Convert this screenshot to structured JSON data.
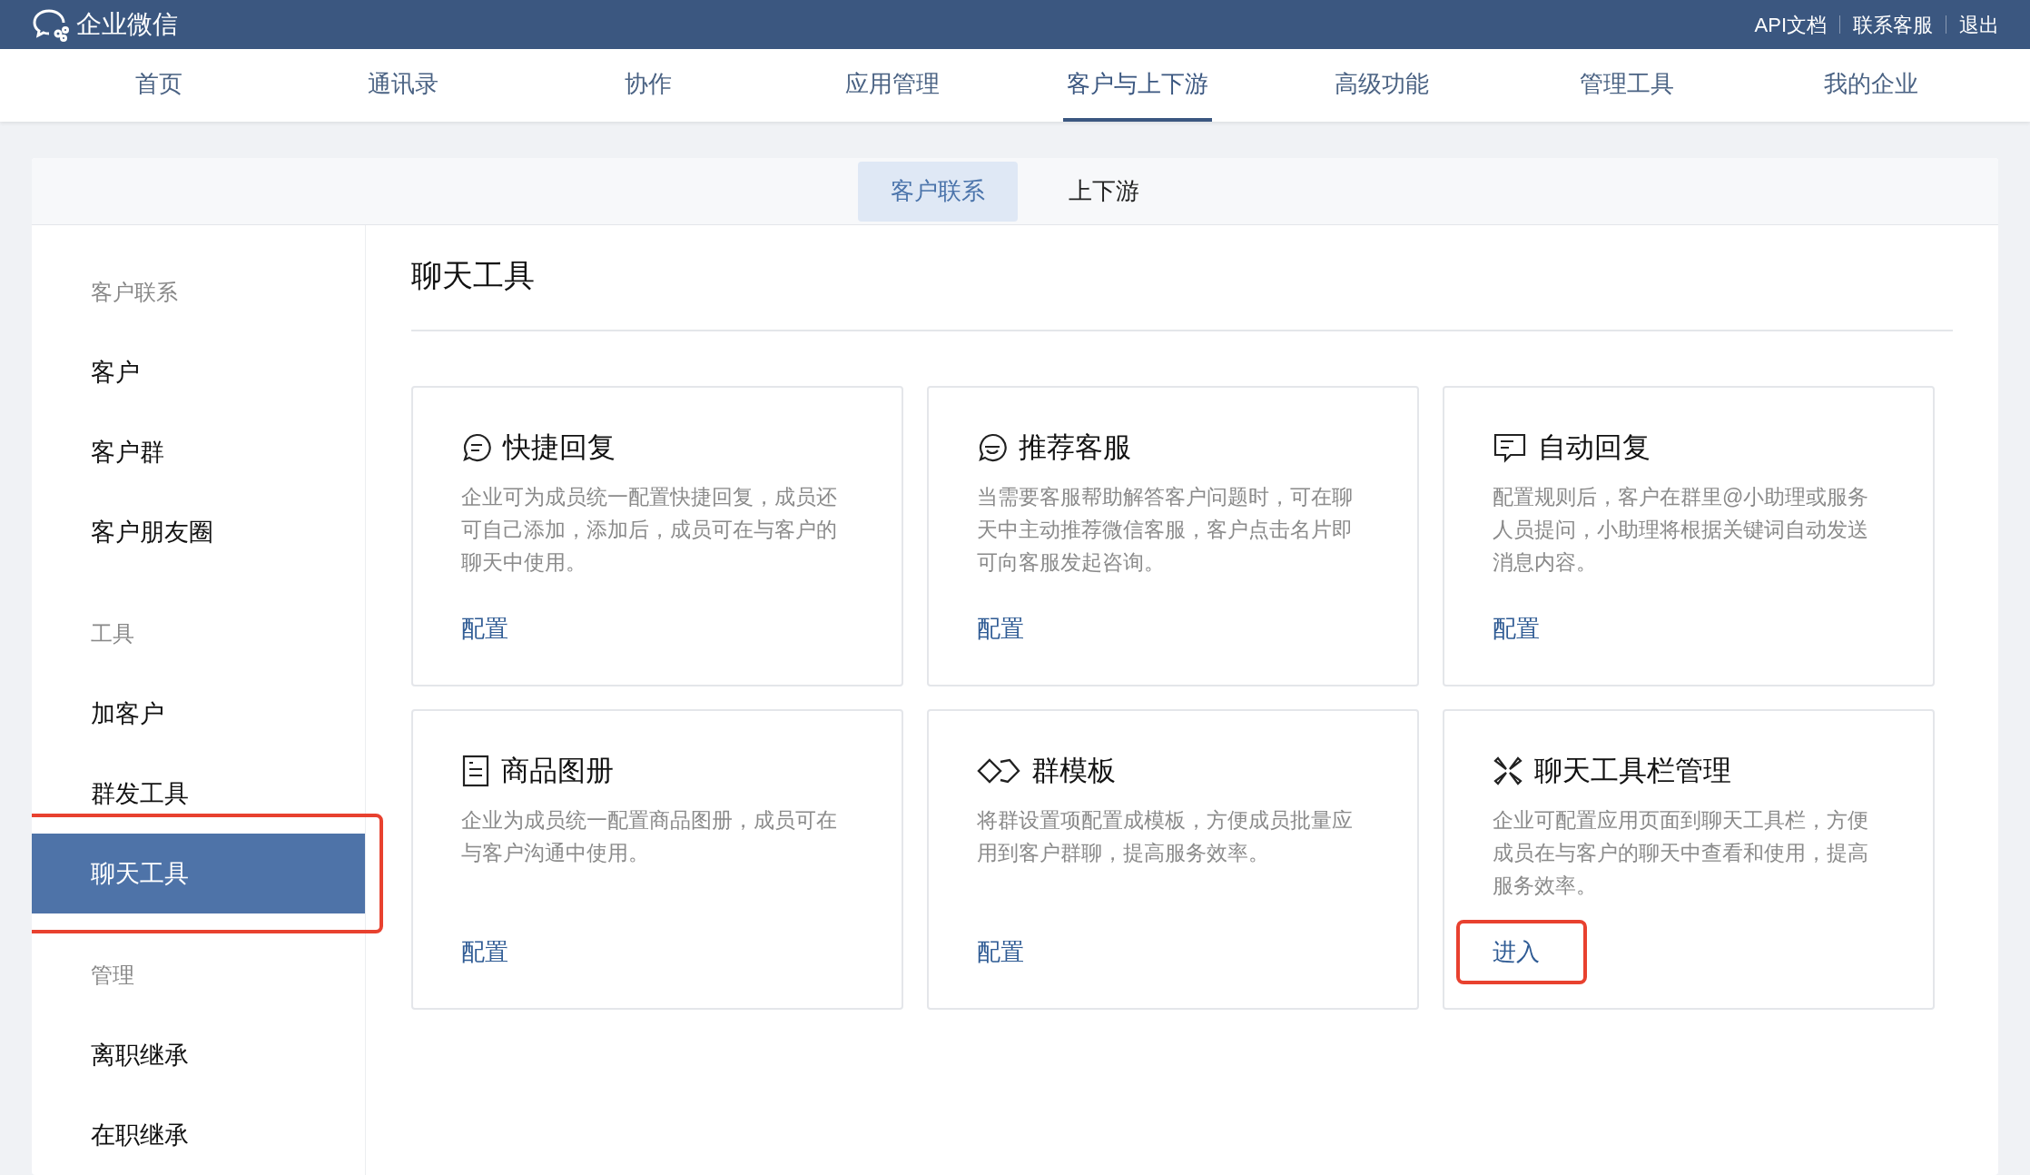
{
  "header": {
    "logo_text": "企业微信",
    "links": [
      "API文档",
      "联系客服",
      "退出"
    ]
  },
  "nav": [
    {
      "label": "首页",
      "selected": false
    },
    {
      "label": "通讯录",
      "selected": false
    },
    {
      "label": "协作",
      "selected": false
    },
    {
      "label": "应用管理",
      "selected": false
    },
    {
      "label": "客户与上下游",
      "selected": true
    },
    {
      "label": "高级功能",
      "selected": false
    },
    {
      "label": "管理工具",
      "selected": false
    },
    {
      "label": "我的企业",
      "selected": false
    }
  ],
  "subtabs": [
    {
      "label": "客户联系",
      "selected": true
    },
    {
      "label": "上下游",
      "selected": false
    }
  ],
  "sidebar": {
    "items": [
      {
        "kind": "group",
        "label": "客户联系"
      },
      {
        "kind": "item",
        "label": "客户",
        "selected": false,
        "highlighted": false
      },
      {
        "kind": "item",
        "label": "客户群",
        "selected": false,
        "highlighted": false
      },
      {
        "kind": "item",
        "label": "客户朋友圈",
        "selected": false,
        "highlighted": false
      },
      {
        "kind": "group",
        "label": "工具"
      },
      {
        "kind": "item",
        "label": "加客户",
        "selected": false,
        "highlighted": false
      },
      {
        "kind": "item",
        "label": "群发工具",
        "selected": false,
        "highlighted": false
      },
      {
        "kind": "item",
        "label": "聊天工具",
        "selected": true,
        "highlighted": true
      },
      {
        "kind": "group",
        "label": "管理"
      },
      {
        "kind": "item",
        "label": "离职继承",
        "selected": false,
        "highlighted": false
      },
      {
        "kind": "item",
        "label": "在职继承",
        "selected": false,
        "highlighted": false
      }
    ]
  },
  "content": {
    "title": "聊天工具",
    "cards": [
      {
        "kind": "quick",
        "title": "快捷回复",
        "description": "企业可为成员统一配置快捷回复，成员还可自己添加，添加后，成员可在与客户的聊天中使用。",
        "action": "配置",
        "highlighted": false
      },
      {
        "kind": "service",
        "title": "推荐客服",
        "description": "当需要客服帮助解答客户问题时，可在聊天中主动推荐微信客服，客户点击名片即可向客服发起咨询。",
        "action": "配置",
        "highlighted": false
      },
      {
        "kind": "auto",
        "title": "自动回复",
        "description": "配置规则后，客户在群里@小助理或服务人员提问，小助理将根据关键词自动发送消息内容。",
        "action": "配置",
        "highlighted": false
      },
      {
        "kind": "catalog",
        "title": "商品图册",
        "description": "企业为成员统一配置商品图册，成员可在与客户沟通中使用。",
        "action": "配置",
        "highlighted": false
      },
      {
        "kind": "template",
        "title": "群模板",
        "description": "将群设置项配置成模板，方便成员批量应用到客户群聊，提高服务效率。",
        "action": "配置",
        "highlighted": false
      },
      {
        "kind": "toolbar",
        "title": "聊天工具栏管理",
        "description": "企业可配置应用页面到聊天工具栏，方便成员在与客户的聊天中查看和使用，提高服务效率。",
        "action": "进入",
        "highlighted": true
      }
    ]
  }
}
